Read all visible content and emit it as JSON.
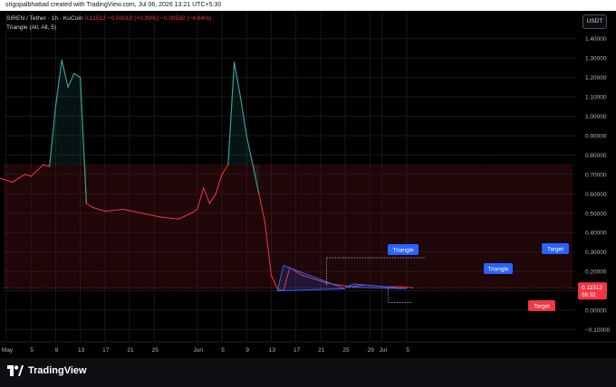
{
  "header": {
    "credit": "srigopalbhattad created with TradingView.com, Jul 06, 2026 13:21 UTC+5:30"
  },
  "legend": {
    "symbol_line": "SIREN / Tether · 1h · KuCoin",
    "price_values": "0.11512 −0.00010 (+0.09%)  −0.00560 (−4.64%)",
    "indicator_line": "Triangle (All, All, 5)"
  },
  "price_axis": {
    "unit_button": "USDT",
    "ticks": [
      "1.40000",
      "1.30000",
      "1.20000",
      "1.10000",
      "1.00000",
      "0.90000",
      "0.80000",
      "0.70000",
      "0.60000",
      "0.50000",
      "0.40000",
      "0.30000",
      "0.20000",
      "0.10000",
      "0.00000",
      "−0.10000"
    ],
    "last_price_label": "0.11512",
    "countdown_label": "08:32"
  },
  "time_axis": {
    "ticks": [
      "May",
      "5",
      "9",
      "13",
      "17",
      "21",
      "25",
      "Jun",
      "5",
      "9",
      "13",
      "17",
      "21",
      "25",
      "29",
      "Jul",
      "5"
    ]
  },
  "annotations": {
    "triangle_label_1": "Triangle",
    "triangle_label_2": "Triangle",
    "target_label_upper": "Target",
    "target_label_lower": "Target"
  },
  "footer": {
    "brand_name": "TradingView"
  },
  "colors": {
    "up": "#26a69a",
    "down": "#f23645",
    "label_blue": "#2962ff",
    "background": "#000000"
  },
  "chart_data": {
    "type": "line",
    "title": "SIREN / Tether · 1h · KuCoin",
    "xlabel": "",
    "ylabel": "",
    "ylim": [
      -0.15,
      1.45
    ],
    "x": [
      "Apr 30",
      "May 2",
      "May 4",
      "May 5",
      "May 6",
      "May 7",
      "May 8",
      "May 9",
      "May 10",
      "May 11",
      "May 12",
      "May 13",
      "May 14",
      "May 15",
      "May 17",
      "May 20",
      "May 23",
      "May 26",
      "May 29",
      "May 31",
      "Jun 1",
      "Jun 2",
      "Jun 3",
      "Jun 4",
      "Jun 5",
      "Jun 6",
      "Jun 7",
      "Jun 8",
      "Jun 9",
      "Jun 10",
      "Jun 11",
      "Jun 12",
      "Jun 13",
      "Jun 14",
      "Jun 15",
      "Jun 16",
      "Jun 18",
      "Jun 20",
      "Jun 22",
      "Jun 24",
      "Jun 26",
      "Jun 28",
      "Jun 30",
      "Jul 2",
      "Jul 4",
      "Jul 6"
    ],
    "series": [
      {
        "values": [
          0.68,
          0.66,
          0.7,
          0.69,
          0.72,
          0.75,
          0.74,
          1.05,
          1.29,
          1.15,
          1.22,
          1.2,
          0.55,
          0.53,
          0.51,
          0.52,
          0.5,
          0.48,
          0.47,
          0.5,
          0.52,
          0.63,
          0.55,
          0.6,
          0.7,
          0.75,
          1.28,
          1.1,
          0.9,
          0.75,
          0.6,
          0.45,
          0.18,
          0.11,
          0.1,
          0.22,
          0.18,
          0.16,
          0.14,
          0.13,
          0.12,
          0.13,
          0.125,
          0.12,
          0.121,
          0.115
        ]
      }
    ],
    "bands": {
      "resistance_top": 0.75,
      "resistance_bottom": 0.115
    },
    "triangle_1": {
      "start": [
        "Jun 14",
        0.1
      ],
      "apex_top": [
        "Jun 15",
        0.23
      ],
      "end": [
        "Jun 25",
        0.11
      ]
    },
    "triangle_2": {
      "start": [
        "Jun 25",
        0.12
      ],
      "end": [
        "Jul 5",
        0.11
      ]
    },
    "target_upper": 0.27,
    "target_lower": 0.04,
    "last_price": 0.11512
  }
}
